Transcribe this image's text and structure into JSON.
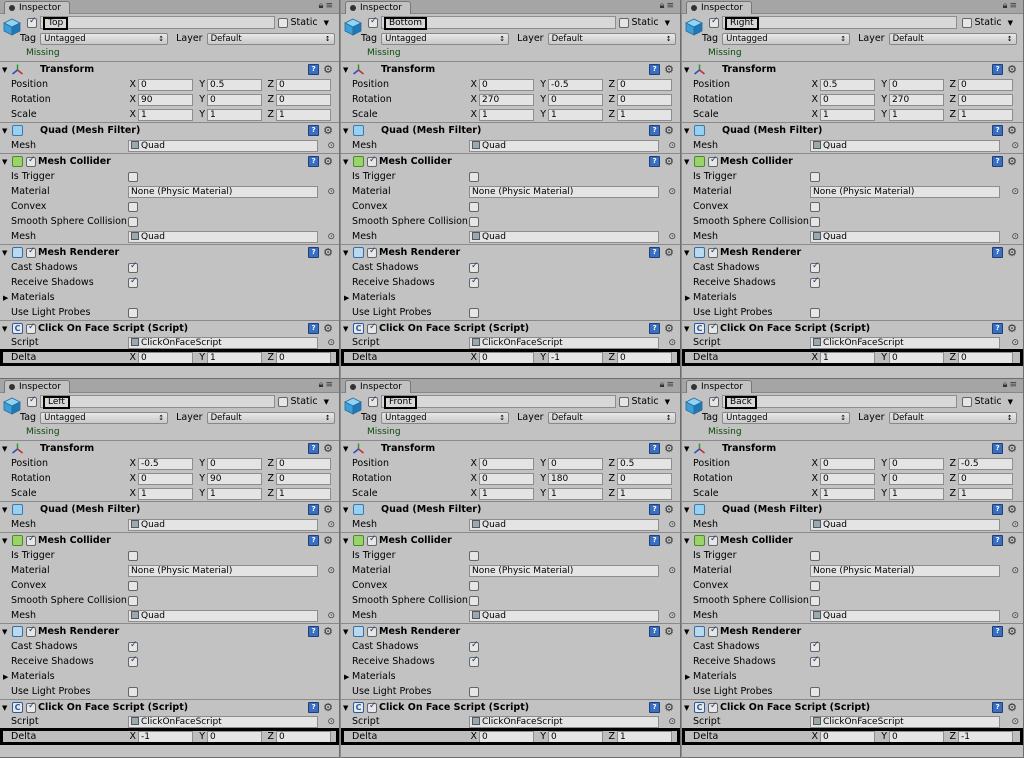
{
  "colors": {
    "panel_bg": "#c2c2c2",
    "book_icon": "#3a6ec0",
    "missing_text": "#0a4a0a"
  },
  "common": {
    "tab_label": "Inspector",
    "static_label": "Static",
    "tag_label": "Tag",
    "tag_value": "Untagged",
    "layer_label": "Layer",
    "layer_value": "Default",
    "missing": "Missing",
    "transform_title": "Transform",
    "position_label": "Position",
    "rotation_label": "Rotation",
    "scale_label": "Scale",
    "meshfilter_title": "Quad (Mesh Filter)",
    "mesh_label": "Mesh",
    "mesh_value": "Quad",
    "collider_title": "Mesh Collider",
    "is_trigger_label": "Is Trigger",
    "material_label": "Material",
    "material_value": "None (Physic Material)",
    "convex_label": "Convex",
    "smooth_label": "Smooth Sphere Collision",
    "renderer_title": "Mesh Renderer",
    "cast_label": "Cast Shadows",
    "receive_label": "Receive Shadows",
    "materials_label": "Materials",
    "probes_label": "Use Light Probes",
    "script_comp_title": "Click On Face Script (Script)",
    "script_label": "Script",
    "script_value": "ClickOnFaceScript",
    "delta_label": "Delta",
    "axis_x": "X",
    "axis_y": "Y",
    "axis_z": "Z"
  },
  "panels": [
    {
      "name": "Top",
      "position": [
        "0",
        "0.5",
        "0"
      ],
      "rotation": [
        "90",
        "0",
        "0"
      ],
      "scale": [
        "1",
        "1",
        "1"
      ],
      "delta": [
        "0",
        "1",
        "0"
      ]
    },
    {
      "name": "Bottom",
      "position": [
        "0",
        "-0.5",
        "0"
      ],
      "rotation": [
        "270",
        "0",
        "0"
      ],
      "scale": [
        "1",
        "1",
        "1"
      ],
      "delta": [
        "0",
        "-1",
        "0"
      ]
    },
    {
      "name": "Right",
      "position": [
        "0.5",
        "0",
        "0"
      ],
      "rotation": [
        "0",
        "270",
        "0"
      ],
      "scale": [
        "1",
        "1",
        "1"
      ],
      "delta": [
        "1",
        "0",
        "0"
      ]
    },
    {
      "name": "Left",
      "position": [
        "-0.5",
        "0",
        "0"
      ],
      "rotation": [
        "0",
        "90",
        "0"
      ],
      "scale": [
        "1",
        "1",
        "1"
      ],
      "delta": [
        "-1",
        "0",
        "0"
      ]
    },
    {
      "name": "Front",
      "position": [
        "0",
        "0",
        "0.5"
      ],
      "rotation": [
        "0",
        "180",
        "0"
      ],
      "scale": [
        "1",
        "1",
        "1"
      ],
      "delta": [
        "0",
        "0",
        "1"
      ]
    },
    {
      "name": "Back",
      "position": [
        "0",
        "0",
        "-0.5"
      ],
      "rotation": [
        "0",
        "0",
        "0"
      ],
      "scale": [
        "1",
        "1",
        "1"
      ],
      "delta": [
        "0",
        "0",
        "-1"
      ]
    }
  ]
}
